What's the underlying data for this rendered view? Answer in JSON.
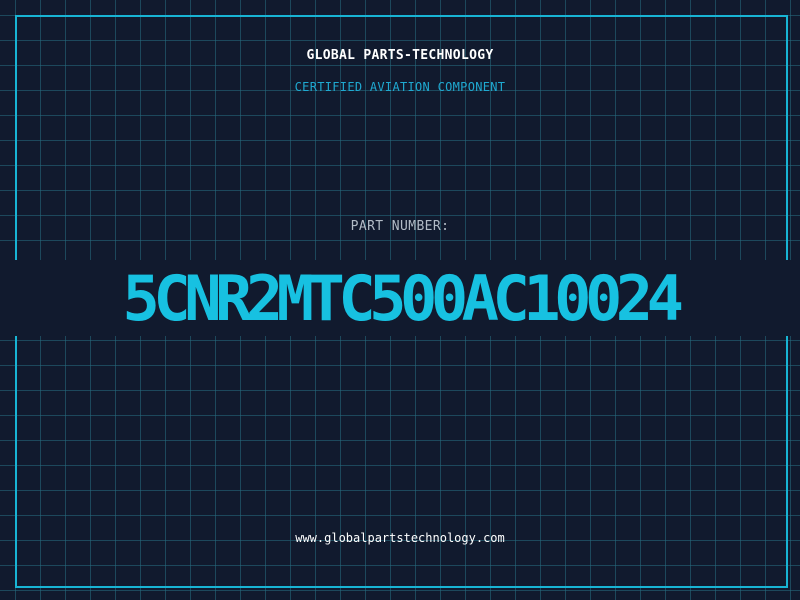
{
  "header": {
    "company": "GLOBAL PARTS-TECHNOLOGY",
    "subtitle": "CERTIFIED AVIATION COMPONENT"
  },
  "part": {
    "label": "PART NUMBER:",
    "number": "5CNR2MTC500AC10024"
  },
  "footer": {
    "website": "www.globalpartstechnology.com"
  },
  "colors": {
    "background": "#111a2e",
    "grid": "#266e82",
    "accent": "#18b4d4",
    "text": "#ffffff"
  }
}
